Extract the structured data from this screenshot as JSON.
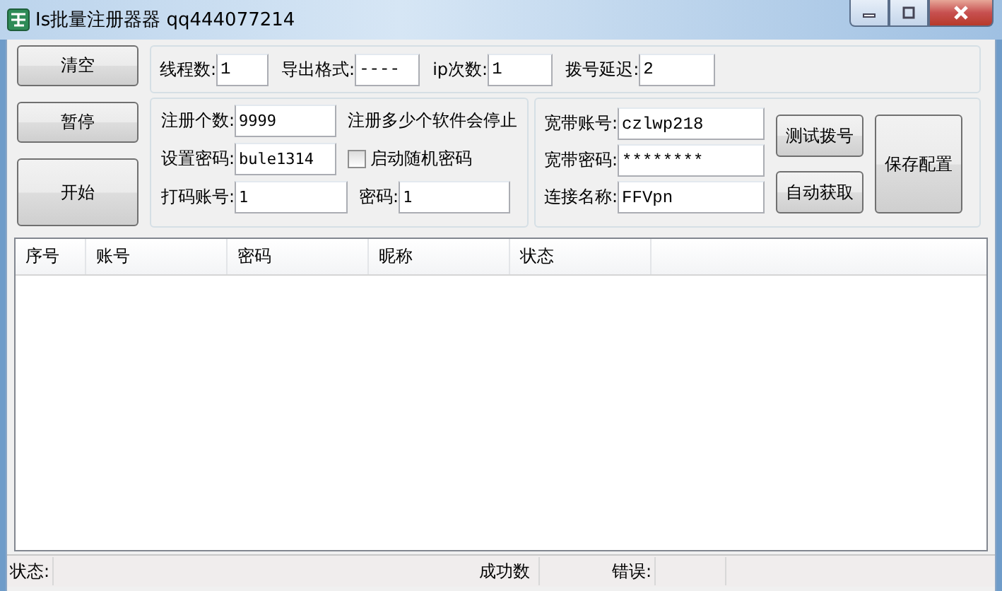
{
  "window": {
    "title": "Is批量注册器器 qq444077214"
  },
  "side_buttons": [
    "清空",
    "暂停",
    "开始"
  ],
  "settings": [
    {
      "label": "线程数:",
      "value": "1"
    },
    {
      "label": "导出格式:",
      "value": "----"
    },
    {
      "label": "ip次数:",
      "value": "1"
    },
    {
      "label": "拨号延迟:",
      "value": "2"
    }
  ],
  "register": {
    "count": {
      "label": "注册个数:",
      "value": "9999"
    },
    "count_note": "注册多少个软件会停止",
    "password": {
      "label": "设置密码:",
      "value": "bule1314"
    },
    "random_password": {
      "label": "启动随机密码",
      "checked": false
    },
    "captcha_account": {
      "label": "打码账号:",
      "value": "1"
    },
    "captcha_password": {
      "label": "密码:",
      "value": "1"
    }
  },
  "broadband": {
    "fields": [
      {
        "label": "宽带账号:",
        "value": "czlwp218"
      },
      {
        "label": "宽带密码:",
        "value": "********"
      },
      {
        "label": "连接名称:",
        "value": "FFVpn"
      }
    ],
    "buttons": [
      "测试拨号",
      "自动获取"
    ],
    "save_button": "保存配置"
  },
  "table": {
    "columns": [
      "序号",
      "账号",
      "密码",
      "昵称",
      "状态"
    ]
  },
  "status_bar": {
    "status_label": "状态:",
    "success_label": "成功数",
    "error_label": "错误:"
  }
}
